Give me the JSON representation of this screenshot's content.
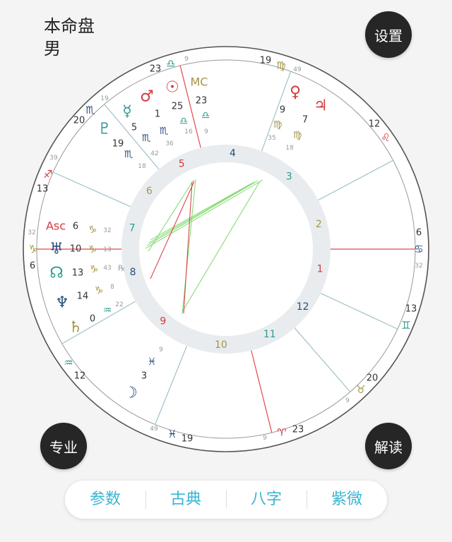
{
  "header": {
    "title": "本命盘",
    "gender": "男"
  },
  "buttons": {
    "settings": "设置",
    "professional": "专业",
    "interpret": "解读"
  },
  "tabs": [
    {
      "label": "参数"
    },
    {
      "label": "古典"
    },
    {
      "label": "八字"
    },
    {
      "label": "紫微"
    }
  ],
  "colors": {
    "fire": "#d8373c",
    "earth": "#a39445",
    "air": "#2a9a8e",
    "water": "#274e7e",
    "accent": "#39b5d3",
    "aspect_green": "#7fd76b",
    "aspect_red": "#d8373c"
  },
  "wheel": {
    "houses": [
      "1",
      "2",
      "3",
      "4",
      "5",
      "6",
      "7",
      "8",
      "9",
      "10",
      "11",
      "12"
    ],
    "cusps": [
      {
        "sign": "♑",
        "sign_name": "capricorn",
        "deg": "6",
        "min": "32"
      },
      {
        "sign": "♒",
        "sign_name": "aquarius",
        "deg": "12",
        "min": ""
      },
      {
        "sign": "♓",
        "sign_name": "pisces",
        "deg": "19",
        "min": "49"
      },
      {
        "sign": "♈",
        "sign_name": "aries",
        "deg": "23",
        "min": "9"
      },
      {
        "sign": "♉",
        "sign_name": "taurus",
        "deg": "20",
        "min": "9"
      },
      {
        "sign": "♊",
        "sign_name": "gemini",
        "deg": "13",
        "min": ""
      },
      {
        "sign": "♋",
        "sign_name": "cancer",
        "deg": "6",
        "min": "32"
      },
      {
        "sign": "♌",
        "sign_name": "leo",
        "deg": "12",
        "min": ""
      },
      {
        "sign": "♍",
        "sign_name": "virgo",
        "deg": "19",
        "min": "49"
      },
      {
        "sign": "♎",
        "sign_name": "libra",
        "deg": "23",
        "min": "9"
      },
      {
        "sign": "♏",
        "sign_name": "scorpio",
        "deg": "20",
        "min": "19"
      },
      {
        "sign": "♐",
        "sign_name": "sagittarius",
        "deg": "13",
        "min": "39"
      }
    ],
    "planets": [
      {
        "name": "mc",
        "glyph": "MC",
        "deg": "23",
        "sign": "♎",
        "min": "9"
      },
      {
        "name": "sun",
        "glyph": "☉",
        "deg": "25",
        "sign": "♎",
        "min": "16"
      },
      {
        "name": "mars",
        "glyph": "♂",
        "deg": "1",
        "sign": "♏",
        "min": "36"
      },
      {
        "name": "mercury",
        "glyph": "☿",
        "deg": "5",
        "sign": "♏",
        "min": "42"
      },
      {
        "name": "pluto",
        "glyph": "♇",
        "deg": "19",
        "sign": "♏",
        "min": "18"
      },
      {
        "name": "venus",
        "glyph": "♀",
        "deg": "9",
        "sign": "♍",
        "min": "35"
      },
      {
        "name": "jupiter",
        "glyph": "♃",
        "deg": "7",
        "sign": "♍",
        "min": "18"
      },
      {
        "name": "asc",
        "glyph": "Asc",
        "deg": "6",
        "sign": "♑",
        "min": "32"
      },
      {
        "name": "uranus",
        "glyph": "♅",
        "deg": "10",
        "sign": "♑",
        "min": "13"
      },
      {
        "name": "node",
        "glyph": "☊",
        "deg": "13",
        "sign": "♑",
        "min": "43",
        "retro": "℞"
      },
      {
        "name": "neptune",
        "glyph": "♆",
        "deg": "14",
        "sign": "♑",
        "min": "8"
      },
      {
        "name": "saturn",
        "glyph": "♄",
        "deg": "0",
        "sign": "♒",
        "min": "22"
      },
      {
        "name": "moon",
        "glyph": "☽",
        "deg": "3",
        "sign": "♓",
        "min": "9"
      }
    ]
  }
}
